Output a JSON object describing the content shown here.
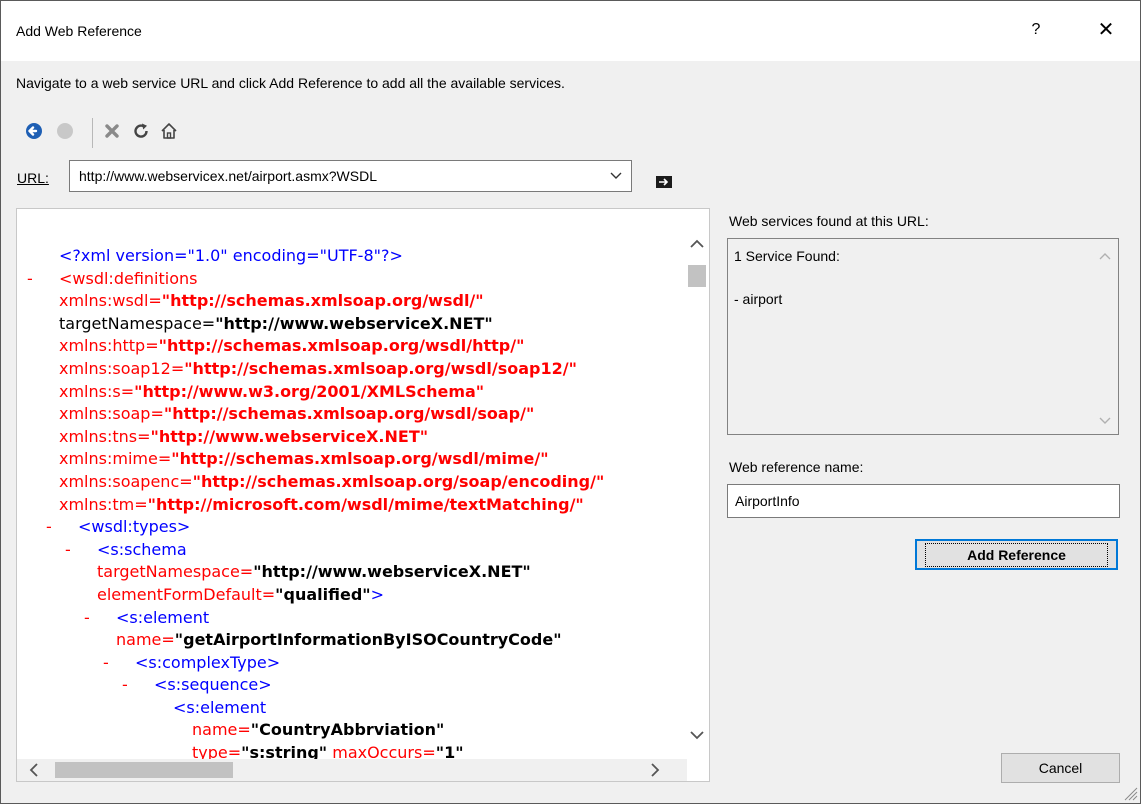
{
  "window": {
    "title": "Add Web Reference",
    "help_glyph": "?",
    "close_glyph": "✕"
  },
  "instructions": "Navigate to a web service URL and click Add Reference to add all the available services.",
  "toolbar": {
    "icons": [
      "back-icon",
      "forward-icon",
      "stop-icon",
      "refresh-icon",
      "home-icon"
    ]
  },
  "url": {
    "label": "URL:",
    "value": "http://www.webservicex.net/airport.asmx?WSDL"
  },
  "xml": {
    "lines": [
      {
        "indent": 0,
        "dash": false,
        "parts": [
          {
            "c": "blue",
            "t": "<?xml version=\"1.0\" encoding=\"UTF-8\"?>"
          }
        ]
      },
      {
        "indent": 0,
        "dash": true,
        "parts": [
          {
            "c": "red",
            "t": "<wsdl:definitions"
          }
        ]
      },
      {
        "indent": 0,
        "dash": false,
        "parts": [
          {
            "c": "red",
            "t": "xmlns:wsdl="
          },
          {
            "c": "val-red",
            "t": "\"http://schemas.xmlsoap.org/wsdl/\""
          }
        ]
      },
      {
        "indent": 0,
        "dash": false,
        "parts": [
          {
            "c": "plain",
            "t": "targetNamespace="
          },
          {
            "c": "val-bold",
            "t": "\"http://www.webserviceX.NET\""
          }
        ]
      },
      {
        "indent": 0,
        "dash": false,
        "parts": [
          {
            "c": "red",
            "t": "xmlns:http="
          },
          {
            "c": "val-red",
            "t": "\"http://schemas.xmlsoap.org/wsdl/http/\""
          }
        ]
      },
      {
        "indent": 0,
        "dash": false,
        "parts": [
          {
            "c": "red",
            "t": "xmlns:soap12="
          },
          {
            "c": "val-red",
            "t": "\"http://schemas.xmlsoap.org/wsdl/soap12/\""
          }
        ]
      },
      {
        "indent": 0,
        "dash": false,
        "parts": [
          {
            "c": "red",
            "t": "xmlns:s="
          },
          {
            "c": "val-red",
            "t": "\"http://www.w3.org/2001/XMLSchema\""
          }
        ]
      },
      {
        "indent": 0,
        "dash": false,
        "parts": [
          {
            "c": "red",
            "t": "xmlns:soap="
          },
          {
            "c": "val-red",
            "t": "\"http://schemas.xmlsoap.org/wsdl/soap/\""
          }
        ]
      },
      {
        "indent": 0,
        "dash": false,
        "parts": [
          {
            "c": "red",
            "t": "xmlns:tns="
          },
          {
            "c": "val-red",
            "t": "\"http://www.webserviceX.NET\""
          }
        ]
      },
      {
        "indent": 0,
        "dash": false,
        "parts": [
          {
            "c": "red",
            "t": "xmlns:mime="
          },
          {
            "c": "val-red",
            "t": "\"http://schemas.xmlsoap.org/wsdl/mime/\""
          }
        ]
      },
      {
        "indent": 0,
        "dash": false,
        "parts": [
          {
            "c": "red",
            "t": "xmlns:soapenc="
          },
          {
            "c": "val-red",
            "t": "\"http://schemas.xmlsoap.org/soap/encoding/\""
          }
        ]
      },
      {
        "indent": 0,
        "dash": false,
        "parts": [
          {
            "c": "red",
            "t": "xmlns:tm="
          },
          {
            "c": "val-red",
            "t": "\"http://microsoft.com/wsdl/mime/textMatching/\""
          }
        ]
      },
      {
        "indent": 1,
        "dash": true,
        "parts": [
          {
            "c": "blue",
            "t": "<wsdl:types>"
          }
        ]
      },
      {
        "indent": 2,
        "dash": true,
        "parts": [
          {
            "c": "blue",
            "t": "<s:schema"
          }
        ]
      },
      {
        "indent": 2,
        "dash": false,
        "parts": [
          {
            "c": "red",
            "t": "targetNamespace="
          },
          {
            "c": "val-bold",
            "t": "\"http://www.webserviceX.NET\""
          }
        ]
      },
      {
        "indent": 2,
        "dash": false,
        "parts": [
          {
            "c": "red",
            "t": "elementFormDefault="
          },
          {
            "c": "val-bold",
            "t": "\"qualified\""
          },
          {
            "c": "blue",
            "t": ">"
          }
        ]
      },
      {
        "indent": 3,
        "dash": true,
        "parts": [
          {
            "c": "blue",
            "t": "<s:element"
          }
        ]
      },
      {
        "indent": 3,
        "dash": false,
        "parts": [
          {
            "c": "red",
            "t": "name="
          },
          {
            "c": "val-bold",
            "t": "\"getAirportInformationByISOCountryCode\""
          }
        ]
      },
      {
        "indent": 4,
        "dash": true,
        "parts": [
          {
            "c": "blue",
            "t": "<s:complexType>"
          }
        ]
      },
      {
        "indent": 5,
        "dash": true,
        "parts": [
          {
            "c": "blue",
            "t": "<s:sequence>"
          }
        ]
      },
      {
        "indent": 6,
        "dash": false,
        "parts": [
          {
            "c": "blue",
            "t": "<s:element"
          }
        ]
      },
      {
        "indent": 7,
        "dash": false,
        "parts": [
          {
            "c": "red",
            "t": "name="
          },
          {
            "c": "val-bold",
            "t": "\"CountryAbbrviation\""
          }
        ]
      },
      {
        "indent": 7,
        "dash": false,
        "parts": [
          {
            "c": "red",
            "t": "type="
          },
          {
            "c": "val-bold",
            "t": "\"s:string\""
          },
          {
            "c": "red",
            "t": " maxOccurs="
          },
          {
            "c": "val-bold",
            "t": "\"1\""
          }
        ]
      }
    ]
  },
  "services": {
    "label": "Web services found at this URL:",
    "count_text": "1 Service Found:",
    "items": [
      "- airport"
    ]
  },
  "reference": {
    "label": "Web reference name:",
    "value": "AirportInfo",
    "add_button": "Add Reference"
  },
  "cancel_button": "Cancel"
}
